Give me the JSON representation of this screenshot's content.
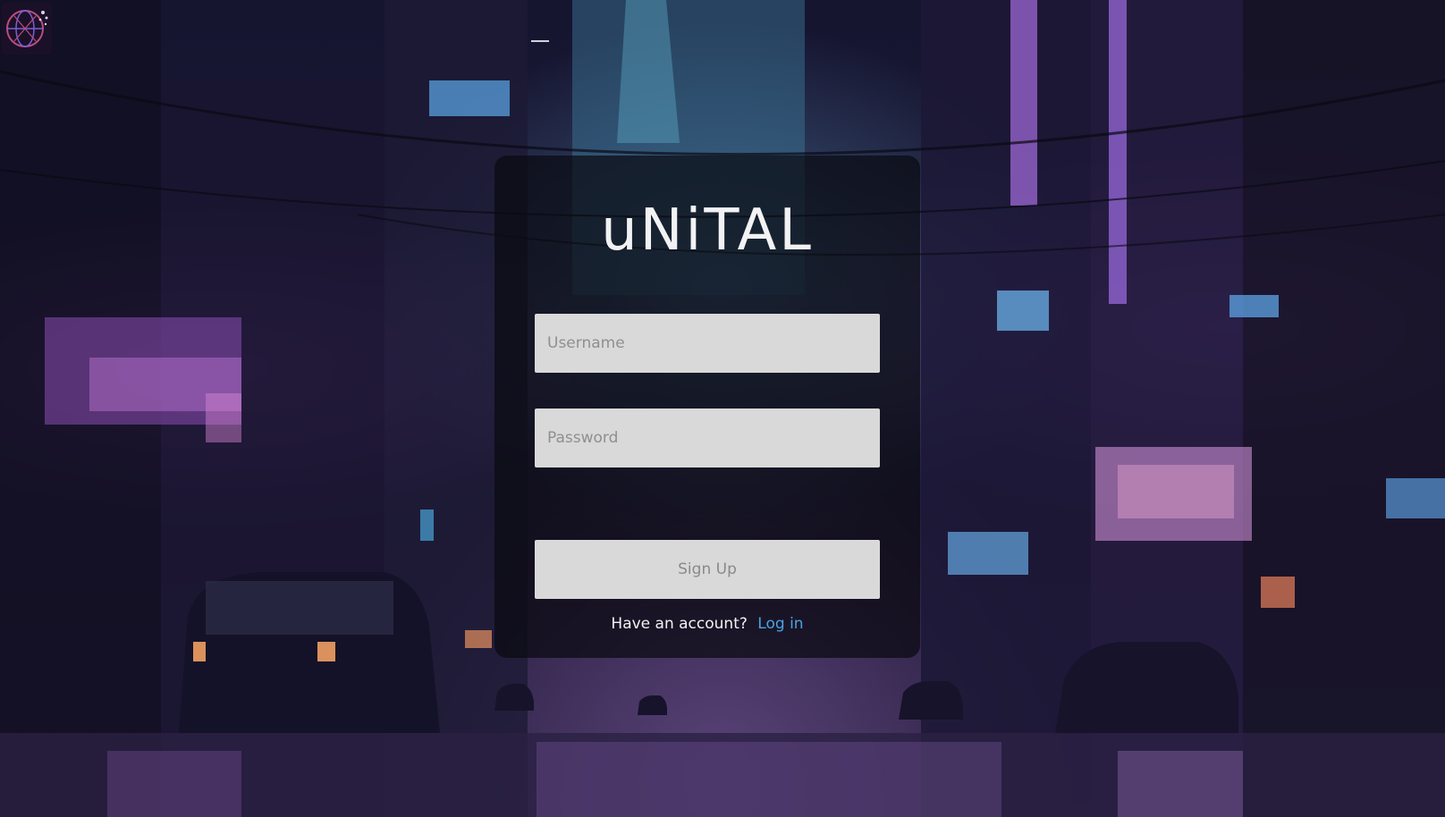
{
  "brand": {
    "name": "uNiTAL"
  },
  "form": {
    "username_placeholder": "Username",
    "username_value": "",
    "password_placeholder": "Password",
    "password_value": "",
    "submit_label": "Sign Up"
  },
  "footer": {
    "prompt": "Have an account?",
    "login_link": "Log in"
  },
  "icons": {
    "logo": "globe-network-icon"
  },
  "colors": {
    "field_bg": "#d9d9d9",
    "link": "#4aa3e6",
    "card_bg": "rgba(10,10,16,0.72)"
  }
}
